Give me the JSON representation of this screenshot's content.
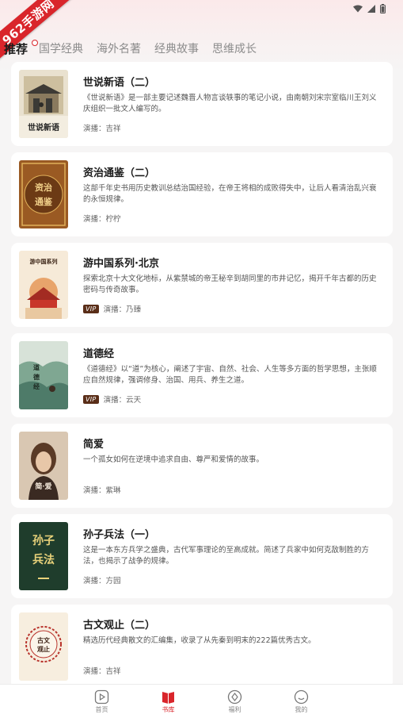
{
  "watermark": "962手游网",
  "status": {
    "wifi_icon": "wifi-icon",
    "signal_icon": "signal-icon",
    "battery_icon": "battery-icon"
  },
  "tabs": [
    {
      "label": "推荐",
      "active": true
    },
    {
      "label": "国学经典",
      "active": false
    },
    {
      "label": "海外名著",
      "active": false
    },
    {
      "label": "经典故事",
      "active": false
    },
    {
      "label": "思维成长",
      "active": false
    }
  ],
  "books": [
    {
      "title": "世说新语（二）",
      "desc": "《世说新语》是一部主要记述魏晋人物言谈轶事的笔记小说，由南朝刘宋宗室临川王刘义庆组织一批文人编写的。",
      "narrator": "演播：吉祥",
      "vip": false,
      "cover_text": "世说新语"
    },
    {
      "title": "资治通鉴（二）",
      "desc": "这部千年史书用历史教训总结治国经验，在帝王将相的成败得失中，让后人看清治乱兴衰的永恒规律。",
      "narrator": "演播：柠柠",
      "vip": false,
      "cover_text": "资治通鉴"
    },
    {
      "title": "游中国系列·北京",
      "desc": "探索北京十大文化地标，从紫禁城的帝王秘辛到胡同里的市井记忆，揭开千年古都的历史密码与传奇故事。",
      "narrator": "演播：乃臻",
      "vip": true,
      "cover_text": "游中国系列"
    },
    {
      "title": "道德经",
      "desc": "《道德经》以“道”为核心，阐述了宇宙、自然、社会、人生等多方面的哲学思想，主张顺应自然规律，强调修身、治国、用兵、养生之道。",
      "narrator": "演播：云天",
      "vip": true,
      "cover_text": "道德经"
    },
    {
      "title": "简爱",
      "desc": "一个孤女如何在逆境中追求自由、尊严和爱情的故事。",
      "narrator": "演播：紫琳",
      "vip": false,
      "cover_text": "简·爱"
    },
    {
      "title": "孙子兵法（一）",
      "desc": "这是一本东方兵学之盛典，古代军事理论的至高成就。简述了兵家中如何克敌制胜的方法，也揭示了战争的规律。",
      "narrator": "演播：方园",
      "vip": false,
      "cover_text": "孙子兵法"
    },
    {
      "title": "古文观止（二）",
      "desc": "精选历代经典散文的汇编集，收录了从先秦到明末的222篇优秀古文。",
      "narrator": "演播：吉祥",
      "vip": false,
      "cover_text": "古文观止"
    }
  ],
  "vip_label": "VIP",
  "bottom_nav": [
    {
      "label": "首页",
      "icon": "play-icon",
      "active": false
    },
    {
      "label": "书库",
      "icon": "book-icon",
      "active": true
    },
    {
      "label": "福利",
      "icon": "gift-icon",
      "active": false
    },
    {
      "label": "我的",
      "icon": "smile-icon",
      "active": false
    }
  ],
  "colors": {
    "accent": "#d9252b",
    "vip_bg": "#5a2e18"
  }
}
